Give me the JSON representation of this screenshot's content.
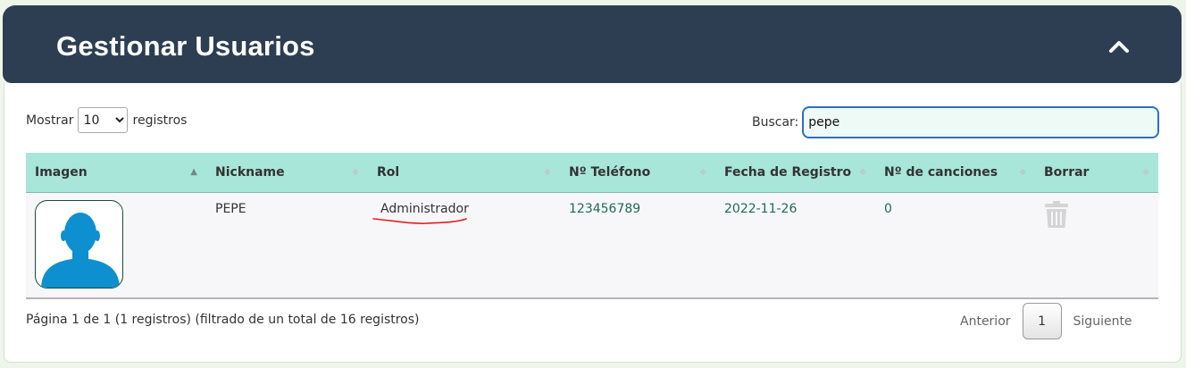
{
  "panel": {
    "title": "Gestionar Usuarios",
    "collapse_icon": "chevron-up-icon"
  },
  "length_control": {
    "prefix": "Mostrar",
    "value": "10",
    "suffix": "registros"
  },
  "search": {
    "label": "Buscar:",
    "value": "pepe"
  },
  "table": {
    "columns": [
      "Imagen",
      "Nickname",
      "Rol",
      "Nº Teléfono",
      "Fecha de Registro",
      "Nº de canciones",
      "Borrar"
    ],
    "rows": [
      {
        "image": "user-avatar-icon",
        "nickname": "PEPE",
        "role": "Administrador",
        "phone": "123456789",
        "registered": "2022-11-26",
        "songs": "0",
        "delete": "trash-icon"
      }
    ]
  },
  "info": "Página 1 de 1 (1 registros) (filtrado de un total de 16 registros)",
  "pagination": {
    "previous": "Anterior",
    "current": "1",
    "next": "Siguiente"
  },
  "colors": {
    "header_bg": "#2e3e52",
    "table_header_bg": "#a8e6da",
    "teal_text": "#1e6b5a",
    "avatar_blue": "#0e8fd0",
    "annotation_red": "#e02020"
  }
}
